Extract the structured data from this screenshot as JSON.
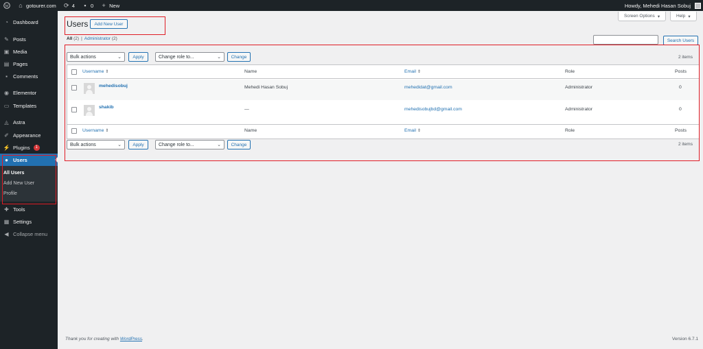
{
  "adminbar": {
    "site_name": "gotourer.com",
    "updates_count": "4",
    "comments_count": "0",
    "new_label": "New",
    "howdy": "Howdy, Mehedi Hasan Sobuj"
  },
  "sidebar": {
    "items": [
      {
        "label": "Dashboard",
        "icon": "dashboard-icon"
      },
      {
        "label": "Posts",
        "icon": "pin-icon"
      },
      {
        "label": "Media",
        "icon": "media-icon"
      },
      {
        "label": "Pages",
        "icon": "pages-icon"
      },
      {
        "label": "Comments",
        "icon": "comment-icon"
      },
      {
        "label": "Elementor",
        "icon": "elementor-icon"
      },
      {
        "label": "Templates",
        "icon": "folder-icon"
      },
      {
        "label": "Astra",
        "icon": "astra-icon"
      },
      {
        "label": "Appearance",
        "icon": "brush-icon"
      },
      {
        "label": "Plugins",
        "icon": "plugin-icon",
        "badge": "1"
      },
      {
        "label": "Users",
        "icon": "user-icon"
      },
      {
        "label": "Tools",
        "icon": "wrench-icon"
      },
      {
        "label": "Settings",
        "icon": "settings-icon"
      }
    ],
    "submenu": [
      "All Users",
      "Add New User",
      "Profile"
    ],
    "collapse_label": "Collapse menu"
  },
  "header": {
    "screen_options": "Screen Options",
    "help": "Help",
    "title": "Users",
    "add_new": "Add New User"
  },
  "filters": {
    "all_label": "All",
    "all_count": "(2)",
    "separator": "|",
    "admin_label": "Administrator",
    "admin_count": "(2)"
  },
  "search": {
    "button": "Search Users"
  },
  "bulk": {
    "bulk_actions": "Bulk actions",
    "apply": "Apply",
    "change_role": "Change role to...",
    "change": "Change",
    "count": "2 items"
  },
  "table": {
    "columns": [
      "Username",
      "Name",
      "Email",
      "Role",
      "Posts"
    ],
    "rows": [
      {
        "username": "mehedisobuj",
        "name": "Mehedi Hasan Sobuj",
        "email": "mehedidat@gmail.com",
        "role": "Administrator",
        "posts": "0"
      },
      {
        "username": "shakib",
        "name": "—",
        "email": "mehedisobujbd@gmail.com",
        "role": "Administrator",
        "posts": "0"
      }
    ]
  },
  "footer": {
    "thanks": "Thank you for creating with",
    "wordpress": "WordPress",
    "period": ".",
    "version": "Version 6.7.1"
  },
  "colors": {
    "adminbar": "#1d2327",
    "accent": "#2271b1",
    "highlight": "#e01b24"
  }
}
